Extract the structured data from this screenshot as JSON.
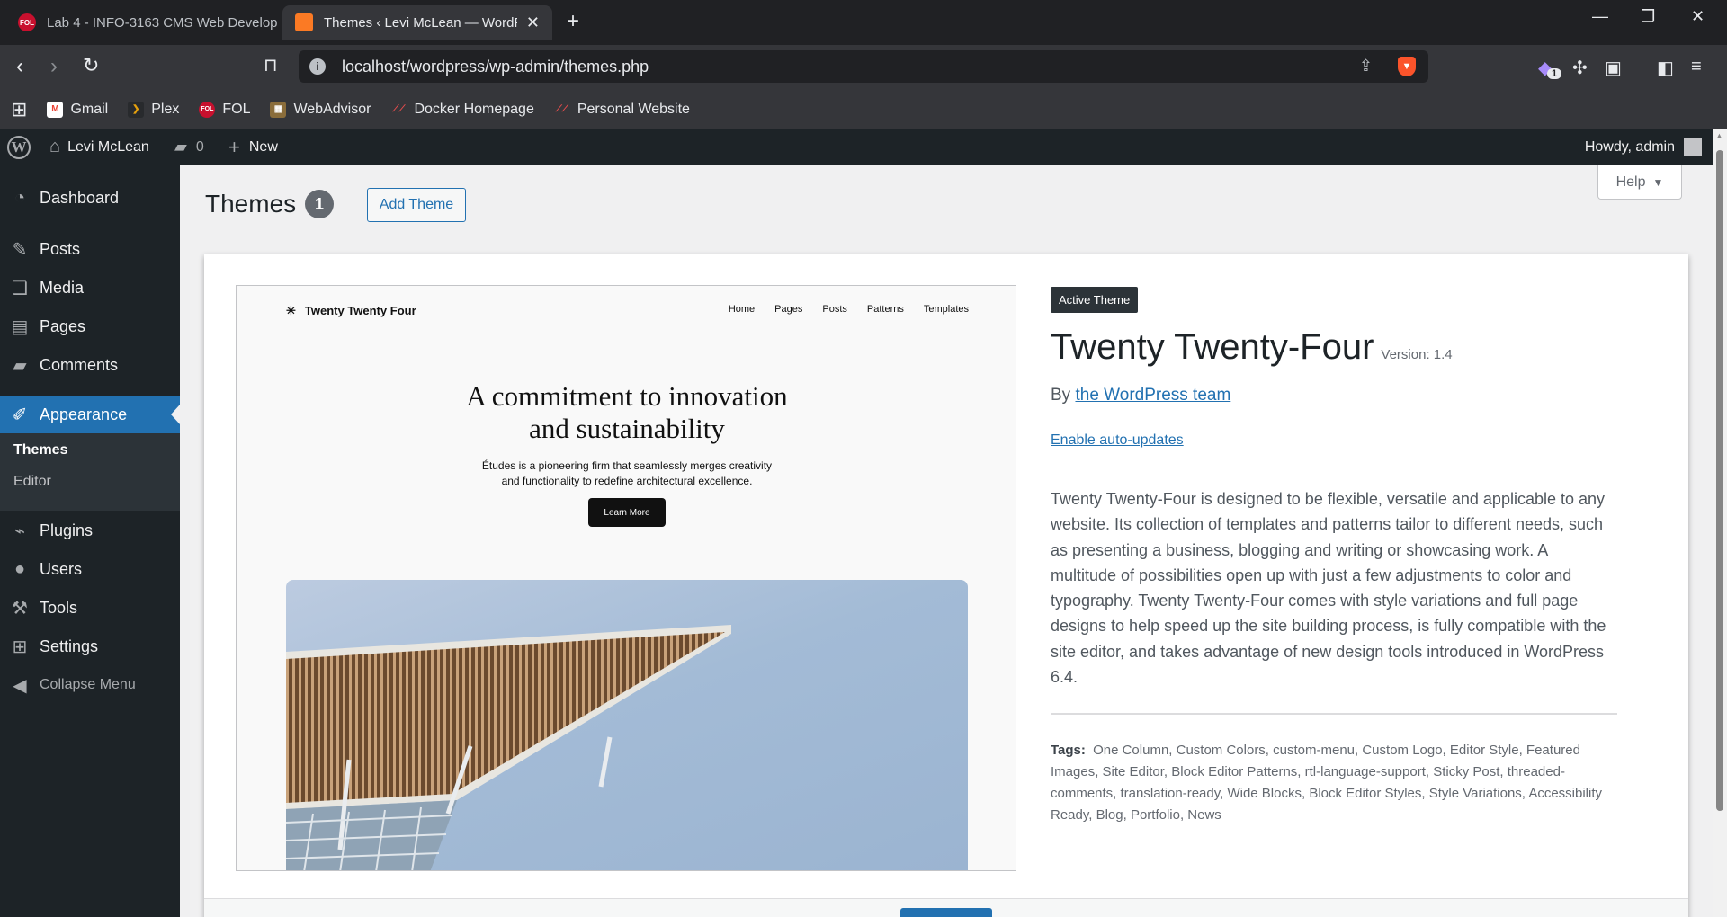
{
  "browser": {
    "tabs": [
      {
        "title": "Lab 4 - INFO-3163 CMS Web Develop",
        "favicon_text": "FOL"
      },
      {
        "title": "Themes ‹ Levi McLean — WordPress",
        "favicon_text": "XAMPP"
      }
    ],
    "new_tab": "+",
    "url": "localhost/wordpress/wp-admin/themes.php",
    "extension_badge": "1",
    "bookmarks": [
      "Gmail",
      "Plex",
      "FOL",
      "WebAdvisor",
      "Docker Homepage",
      "Personal Website"
    ]
  },
  "adminbar": {
    "site_name": "Levi McLean",
    "comments_count": "0",
    "new_label": "New",
    "greeting": "Howdy, admin"
  },
  "sidebar": {
    "items": [
      {
        "label": "Dashboard",
        "icon": "dashboard-icon"
      },
      {
        "label": "Posts",
        "icon": "pin-icon"
      },
      {
        "label": "Media",
        "icon": "media-icon"
      },
      {
        "label": "Pages",
        "icon": "pages-icon"
      },
      {
        "label": "Comments",
        "icon": "comments-icon"
      },
      {
        "label": "Appearance",
        "icon": "brush-icon"
      },
      {
        "label": "Plugins",
        "icon": "plug-icon"
      },
      {
        "label": "Users",
        "icon": "user-icon"
      },
      {
        "label": "Tools",
        "icon": "wrench-icon"
      },
      {
        "label": "Settings",
        "icon": "settings-icon"
      },
      {
        "label": "Collapse Menu",
        "icon": "collapse-icon"
      }
    ],
    "submenu": [
      "Themes",
      "Editor"
    ]
  },
  "page": {
    "title": "Themes",
    "count": "1",
    "add_button": "Add Theme",
    "help": "Help"
  },
  "theme": {
    "active_badge": "Active Theme",
    "name": "Twenty Twenty-Four",
    "version": "Version: 1.4",
    "by": "By",
    "author": "the WordPress team",
    "auto_updates": "Enable auto-updates",
    "description": "Twenty Twenty-Four is designed to be flexible, versatile and applicable to any website. Its collection of templates and patterns tailor to different needs, such as presenting a business, blogging and writing or showcasing work. A multitude of possibilities open up with just a few adjustments to color and typography. Twenty Twenty-Four comes with style variations and full page designs to help speed up the site building process, is fully compatible with the site editor, and takes advantage of new design tools introduced in WordPress 6.4.",
    "tags_label": "Tags:",
    "tags": "One Column, Custom Colors, custom-menu, Custom Logo, Editor Style, Featured Images, Site Editor, Block Editor Patterns, rtl-language-support, Sticky Post, threaded-comments, translation-ready, Wide Blocks, Block Editor Styles, Style Variations, Accessibility Ready, Blog, Portfolio, News"
  },
  "screenshot": {
    "logo": "Twenty Twenty Four",
    "nav": [
      "Home",
      "Pages",
      "Posts",
      "Patterns",
      "Templates"
    ],
    "heading_line1": "A commitment to innovation",
    "heading_line2": "and sustainability",
    "sub_line1": "Études is a pioneering firm that seamlessly merges creativity",
    "sub_line2": "and functionality to redefine architectural excellence.",
    "button": "Learn More"
  }
}
